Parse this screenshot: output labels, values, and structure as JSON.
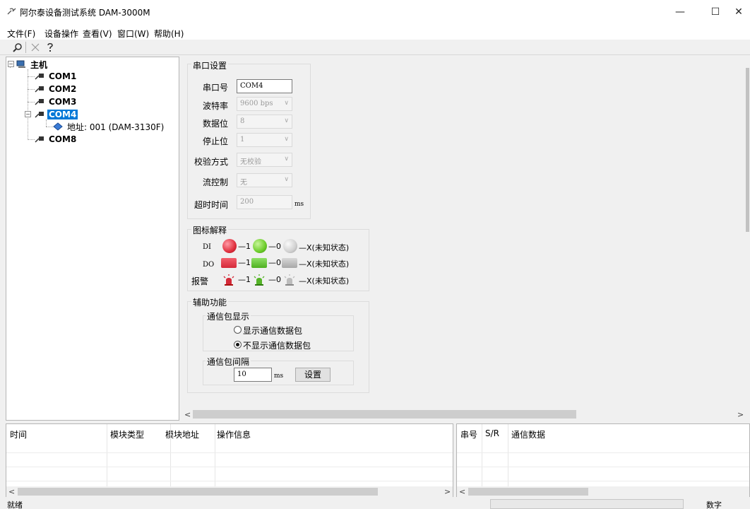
{
  "window": {
    "title": "阿尔泰设备测试系统 DAM-3000M",
    "minimize": "—",
    "maximize": "☐",
    "close": "✕"
  },
  "menu": [
    "文件(F)",
    "设备操作",
    "查看(V)",
    "窗口(W)",
    "帮助(H)"
  ],
  "toolbar": {
    "icons": [
      "search-icon",
      "close-icon",
      "help-icon"
    ],
    "search": "⚲",
    "close": "✕",
    "help": "?"
  },
  "tree": {
    "root": "主机",
    "ports": [
      "COM1",
      "COM2",
      "COM3",
      "COM4",
      "COM8"
    ],
    "selected": "COM4",
    "device": "地址: 001 (DAM-3130F)"
  },
  "serial": {
    "group_title": "串口设置",
    "port_label": "串口号",
    "port_value": "COM4",
    "baud_label": "波特率",
    "baud_value": "9600 bps",
    "data_bits_label": "数据位",
    "data_bits_value": "8",
    "stop_bits_label": "停止位",
    "stop_bits_value": "1",
    "parity_label": "校验方式",
    "parity_value": "无校验",
    "flow_label": "流控制",
    "flow_value": "无",
    "timeout_label": "超时时间",
    "timeout_value": "200",
    "timeout_unit": "ms"
  },
  "legend": {
    "group_title": "图标解释",
    "rows": [
      {
        "label": "DI",
        "on": "—1",
        "off": "—0",
        "unknown": "—X(未知状态)"
      },
      {
        "label": "DO",
        "on": "—1",
        "off": "—0",
        "unknown": "—X(未知状态)"
      },
      {
        "label": "报警",
        "on": "—1",
        "off": "—0",
        "unknown": "—X(未知状态)"
      }
    ]
  },
  "aux": {
    "group_title": "辅助功能",
    "packet_display_title": "通信包显示",
    "show_packets": "显示通信数据包",
    "hide_packets": "不显示通信数据包",
    "selected_option": "hide",
    "interval_title": "通信包间隔",
    "interval_value": "10",
    "interval_unit": "ms",
    "set_button": "设置"
  },
  "log_table": {
    "columns": [
      "时间",
      "模块类型",
      "模块地址",
      "操作信息"
    ]
  },
  "packet_table": {
    "columns": [
      "串号",
      "S/R",
      "通信数据"
    ]
  },
  "status": {
    "left": "就绪",
    "right": "数字"
  },
  "colors": {
    "selection": "#0078d7",
    "on_red": "#e0303e",
    "off_green": "#6ccc2a",
    "unknown_gray": "#c8c8c8"
  }
}
